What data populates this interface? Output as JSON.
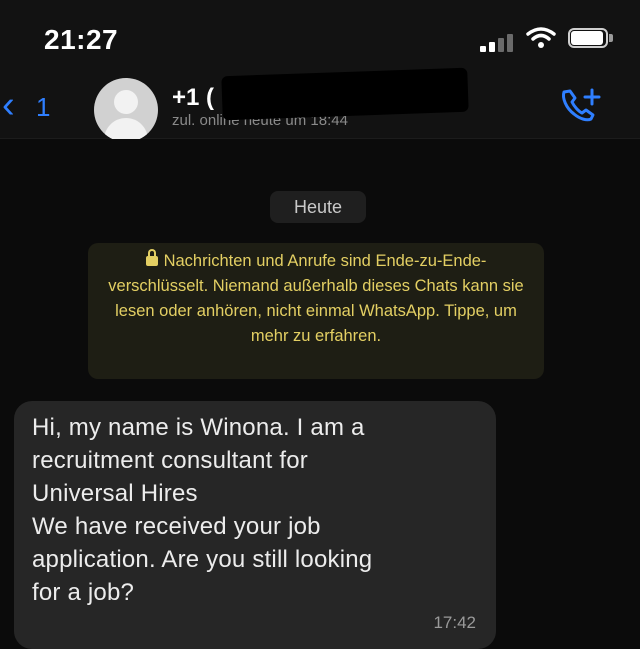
{
  "status_bar": {
    "time": "21:27"
  },
  "header": {
    "back_count": "1",
    "contact_name": "+1 (",
    "contact_status": "zul. online heute um 18:44"
  },
  "chat": {
    "date_label": "Heute",
    "encryption_notice": "Nachrichten und Anrufe sind Ende-zu-Ende-verschlüsselt. Niemand außerhalb dieses Chats kann sie lesen oder anhören, nicht einmal WhatsApp. Tippe, um mehr zu erfahren.",
    "messages": [
      {
        "text": "Hi, my name is Winona. I am a\nrecruitment consultant for\nUniversal Hires\nWe have received your job\napplication. Are you still looking\nfor a job?",
        "time": "17:42"
      }
    ]
  },
  "icons": {
    "back": "chevron-left-icon",
    "avatar": "person-icon",
    "call": "phone-plus-icon",
    "lock": "lock-icon",
    "signal": "signal-icon",
    "wifi": "wifi-icon",
    "battery": "battery-icon"
  },
  "colors": {
    "accent_blue": "#2f7fff",
    "notice_text": "#e3cf63",
    "bubble_bg": "#262626",
    "background": "#0b0b0b"
  }
}
